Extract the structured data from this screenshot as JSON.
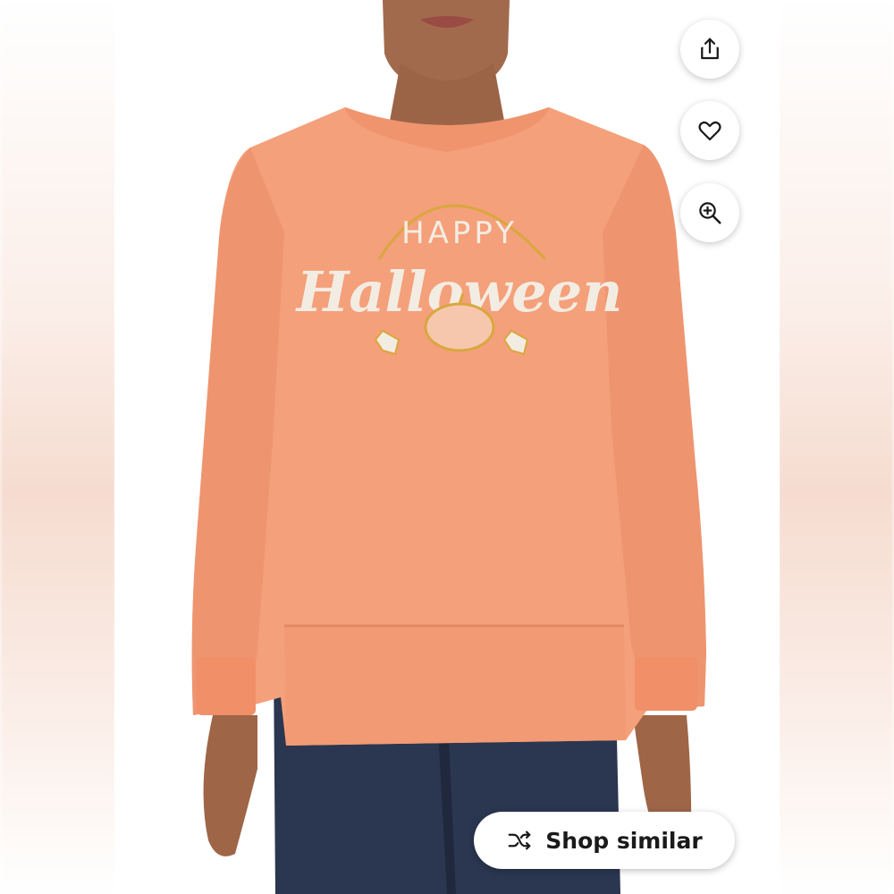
{
  "product_image": {
    "graphic_line1": "HAPPY",
    "graphic_line2": "Halloween"
  },
  "actions": {
    "share_icon": "share-icon",
    "favorite_icon": "heart-icon",
    "zoom_icon": "zoom-in-icon"
  },
  "shop_similar": {
    "icon": "shuffle-icon",
    "label": "Shop similar"
  },
  "colors": {
    "sweatshirt": "#f4a07a",
    "jeans": "#2b3650",
    "graphic": "#f3ece2",
    "gold": "#d9a73e"
  }
}
